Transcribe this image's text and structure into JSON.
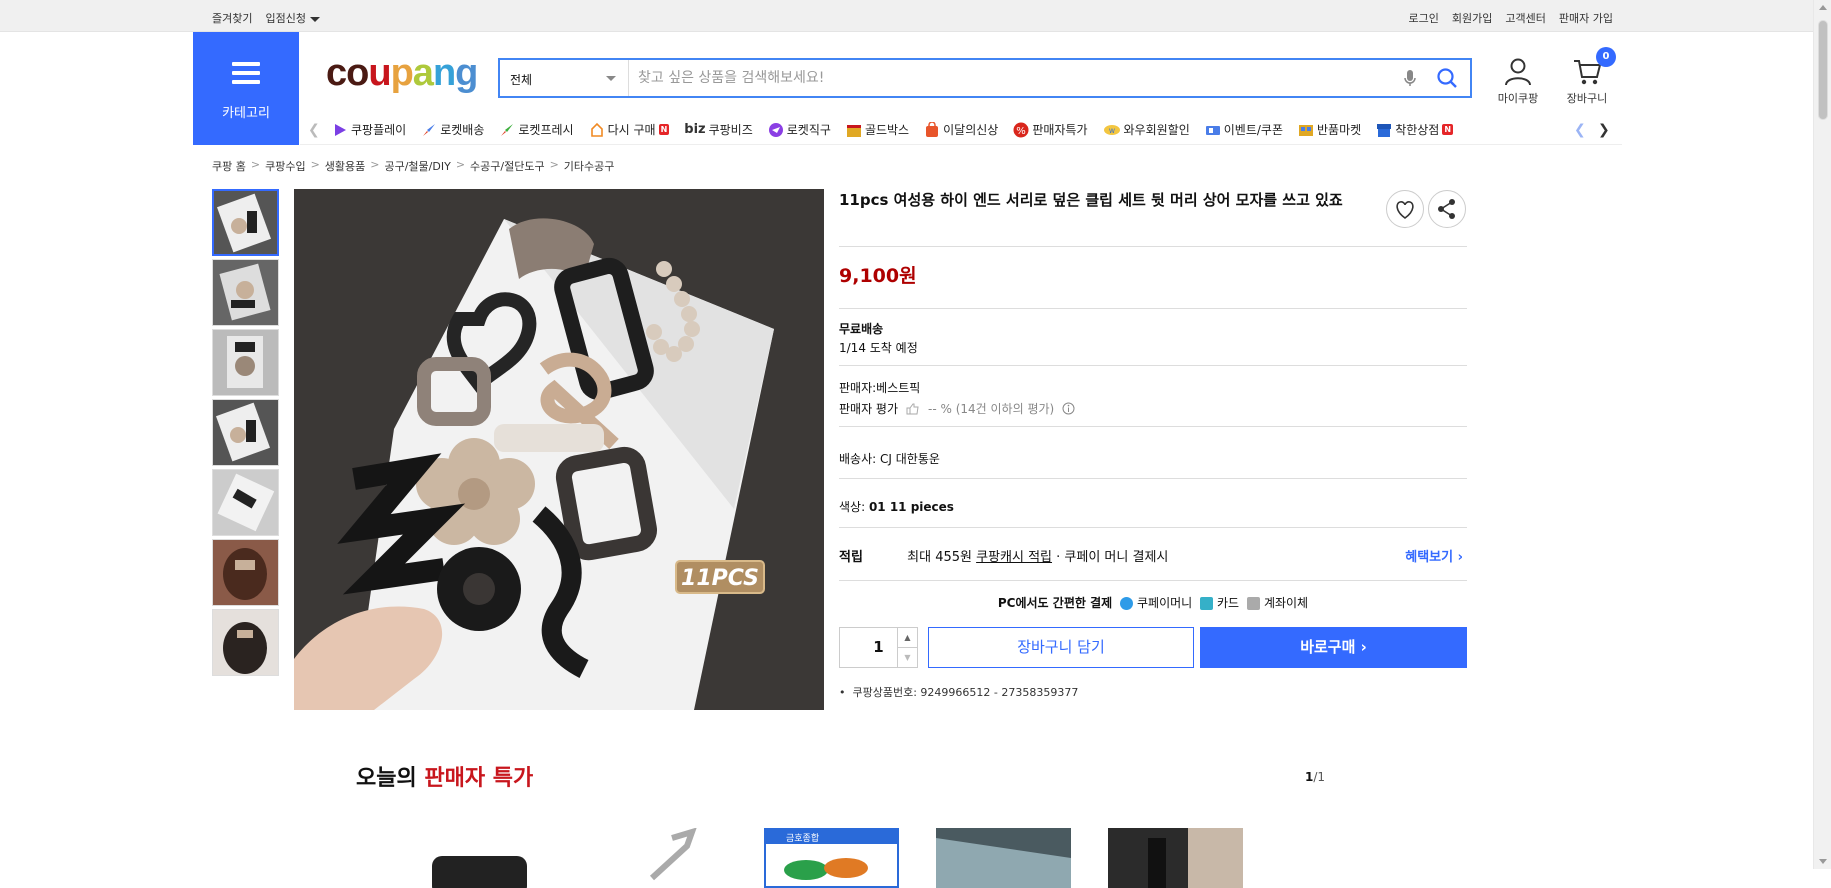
{
  "topbar": {
    "favorites": "즐겨찾기",
    "store_apply": "입점신청",
    "login": "로그인",
    "signup": "회원가입",
    "support": "고객센터",
    "seller_signup": "판매자 가입"
  },
  "header": {
    "category_label": "카테고리",
    "logo": {
      "c1": "co",
      "c2": "u",
      "c3": "p",
      "c4": "a",
      "c5": "n",
      "c6": "g"
    },
    "search": {
      "category": "전체",
      "placeholder": "찾고 싶은 상품을 검색해보세요!"
    },
    "my_coupang": "마이쿠팡",
    "cart_label": "장바구니",
    "cart_count": "0"
  },
  "nav": {
    "items": [
      {
        "label": "쿠팡플레이",
        "icon": "play-icon",
        "color": "#7b3fe4"
      },
      {
        "label": "로켓배송",
        "icon": "rocket-icon",
        "color": "#e0452b"
      },
      {
        "label": "로켓프레시",
        "icon": "rocket-fresh-icon",
        "color": "#3cae3c"
      },
      {
        "label": "다시 구매",
        "icon": "rebuy-icon",
        "color": "#f08a24",
        "badge": "N"
      },
      {
        "label": "쿠팡비즈",
        "prefix": "biz",
        "icon": "biz-icon",
        "color": "#333333"
      },
      {
        "label": "로켓직구",
        "icon": "global-icon",
        "color": "#8b3fe4"
      },
      {
        "label": "골드박스",
        "icon": "goldbox-icon",
        "color": "#e0a824"
      },
      {
        "label": "이달의신상",
        "icon": "new-icon",
        "color": "#e8552b"
      },
      {
        "label": "판매자특가",
        "icon": "percent-icon",
        "color": "#d9261c"
      },
      {
        "label": "와우회원할인",
        "icon": "wow-icon",
        "color": "#e03c2b"
      },
      {
        "label": "이벤트/쿠폰",
        "icon": "coupon-icon",
        "color": "#4a7de8"
      },
      {
        "label": "반품마켓",
        "icon": "return-market-icon",
        "color": "#e0a824"
      },
      {
        "label": "착한상점",
        "icon": "good-store-icon",
        "color": "#2a6ad9",
        "badge": "N"
      }
    ],
    "new_badge": "N"
  },
  "breadcrumb": [
    "쿠팡 홈",
    "쿠팡수입",
    "생활용품",
    "공구/철물/DIY",
    "수공구/절단도구",
    "기타수공구"
  ],
  "product": {
    "title": "11pcs 여성용 하이 엔드 서리로 덮은 클립 세트 뒷 머리 상어 모자를 쓰고 있죠",
    "price": "9,100원",
    "shipping_title": "무료배송",
    "arrival": "1/14 도착 예정",
    "seller_label": "판매자:",
    "seller": "베스트픽",
    "seller_rating_label": "판매자 평가",
    "seller_rating_value": "-- % (14건 이하의 평가)",
    "carrier_label": "배송사:",
    "carrier": "CJ 대한통운",
    "color_label": "색상:",
    "color_value": "01 11 pieces",
    "reward_label": "적립",
    "reward_max": "최대 455원",
    "reward_cash": "쿠팡캐시 적립",
    "reward_suffix": "· 쿠페이 머니 결제시",
    "benefit_link": "혜택보기",
    "pay_title": "PC에서도 간편한 결제",
    "pay_methods": [
      "쿠페이머니",
      "카드",
      "계좌이체"
    ],
    "quantity": "1",
    "add_to_cart": "장바구니 담기",
    "buy_now": "바로구매",
    "product_no_label": "쿠팡상품번호:",
    "product_no": "9249966512 - 27358359377",
    "image_badge": "11PCS",
    "thumb_count": 7
  },
  "deals": {
    "title_prefix": "오늘의",
    "title_highlight": "판매자 특가",
    "page_current": "1",
    "page_total": "/1",
    "card3_banner": "금호종합"
  },
  "colors": {
    "accent": "#346aff",
    "price": "#ae0000",
    "deal_red": "#c8161d"
  }
}
